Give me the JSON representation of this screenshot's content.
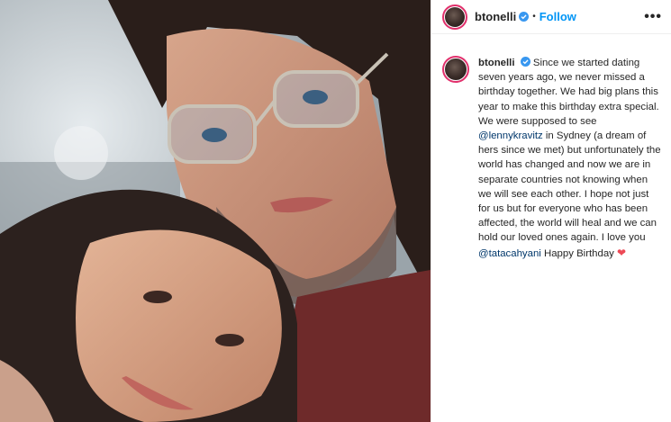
{
  "post": {
    "username": "btonelli",
    "separator": "•",
    "follow_label": "Follow",
    "more_icon": "more-options-icon",
    "caption_parts": {
      "p1": "Since we started dating seven years ago, we never missed a birthday together. We had big plans this year to make this birthday extra special. We were supposed to see ",
      "mention1": "@lennykravitz",
      "p2": " in Sydney (a dream of hers since we met) but unfortunately the world has changed and now we are in separate countries not knowing when we will see each other. I hope not just for us but for everyone who has been affected, the world will heal and we can hold our loved ones again. I love you ",
      "mention2": "@tatacahyani",
      "p3": " Happy Birthday ",
      "emoji": "❤"
    }
  },
  "colors": {
    "accent": "#0095f6",
    "verified": "#3897f0",
    "mention": "#00376b",
    "heart": "#ed4956"
  }
}
